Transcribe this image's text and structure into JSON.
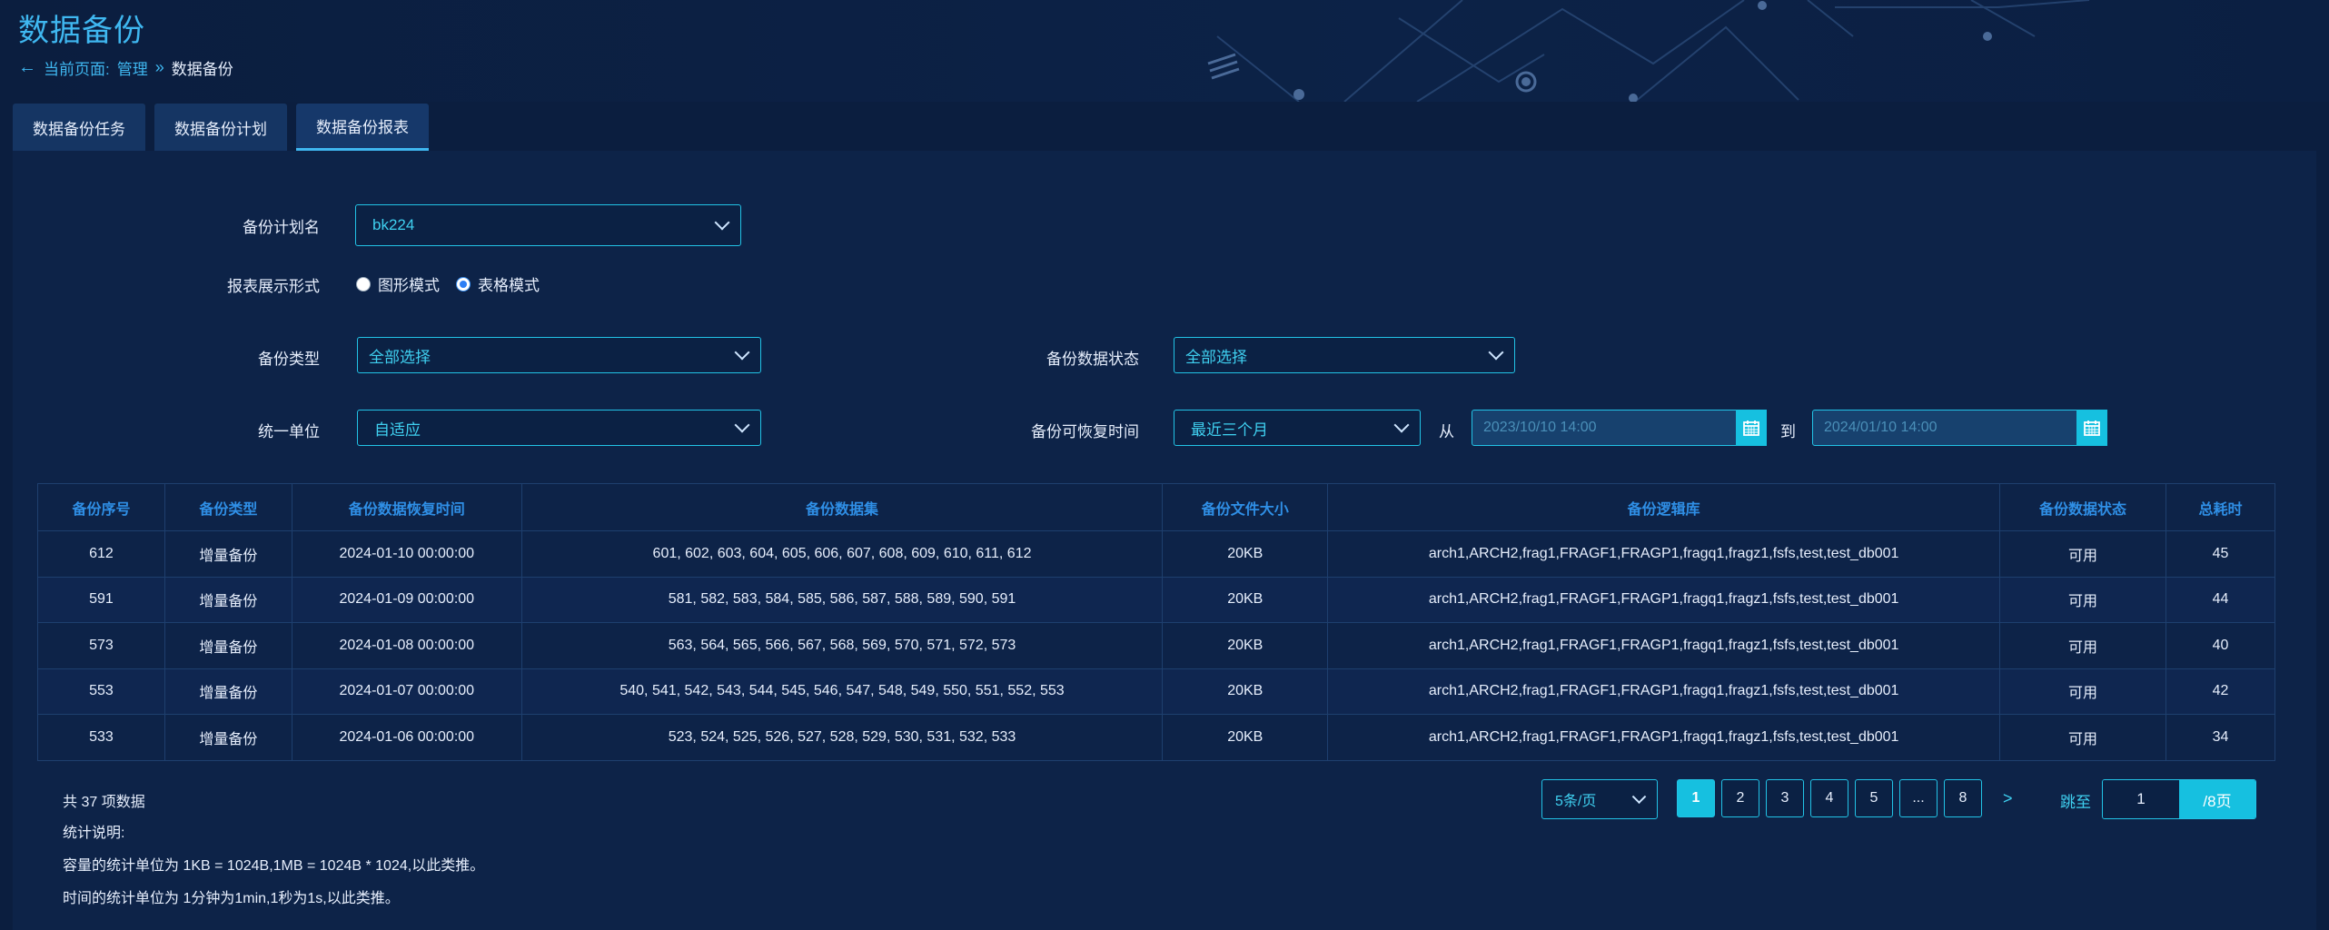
{
  "header": {
    "title": "数据备份",
    "breadcrumb": {
      "back_icon": "arrow-left-icon",
      "prefix": "当前页面:",
      "parent": "管理",
      "separator": "»",
      "current": "数据备份"
    }
  },
  "tabs": [
    {
      "label": "数据备份任务",
      "active": false
    },
    {
      "label": "数据备份计划",
      "active": false
    },
    {
      "label": "数据备份报表",
      "active": true
    }
  ],
  "form": {
    "plan_name": {
      "label": "备份计划名",
      "value": "bk224"
    },
    "display_mode": {
      "label": "报表展示形式",
      "options": [
        {
          "label": "图形模式",
          "selected": false
        },
        {
          "label": "表格模式",
          "selected": true
        }
      ]
    },
    "backup_type": {
      "label": "备份类型",
      "value": "全部选择"
    },
    "data_status": {
      "label": "备份数据状态",
      "value": "全部选择"
    },
    "unit": {
      "label": "统一单位",
      "value": "自适应"
    },
    "restore_time": {
      "label": "备份可恢复时间",
      "range_value": "最近三个月",
      "from_label": "从",
      "from_value": "2023/10/10 14:00",
      "to_label": "到",
      "to_value": "2024/01/10 14:00",
      "calendar_icon": "calendar-icon"
    }
  },
  "table": {
    "columns": [
      "备份序号",
      "备份类型",
      "备份数据恢复时间",
      "备份数据集",
      "备份文件大小",
      "备份逻辑库",
      "备份数据状态",
      "总耗时"
    ],
    "rows": [
      [
        "612",
        "增量备份",
        "2024-01-10 00:00:00",
        "601, 602, 603, 604, 605, 606, 607, 608, 609, 610, 611, 612",
        "20KB",
        "arch1,ARCH2,frag1,FRAGF1,FRAGP1,fragq1,fragz1,fsfs,test,test_db001",
        "可用",
        "45"
      ],
      [
        "591",
        "增量备份",
        "2024-01-09 00:00:00",
        "581, 582, 583, 584, 585, 586, 587, 588, 589, 590, 591",
        "20KB",
        "arch1,ARCH2,frag1,FRAGF1,FRAGP1,fragq1,fragz1,fsfs,test,test_db001",
        "可用",
        "44"
      ],
      [
        "573",
        "增量备份",
        "2024-01-08 00:00:00",
        "563, 564, 565, 566, 567, 568, 569, 570, 571, 572, 573",
        "20KB",
        "arch1,ARCH2,frag1,FRAGF1,FRAGP1,fragq1,fragz1,fsfs,test,test_db001",
        "可用",
        "40"
      ],
      [
        "553",
        "增量备份",
        "2024-01-07 00:00:00",
        "540, 541, 542, 543, 544, 545, 546, 547, 548, 549, 550, 551, 552, 553",
        "20KB",
        "arch1,ARCH2,frag1,FRAGF1,FRAGP1,fragq1,fragz1,fsfs,test,test_db001",
        "可用",
        "42"
      ],
      [
        "533",
        "增量备份",
        "2024-01-06 00:00:00",
        "523, 524, 525, 526, 527, 528, 529, 530, 531, 532, 533",
        "20KB",
        "arch1,ARCH2,frag1,FRAGF1,FRAGP1,fragq1,fragz1,fsfs,test,test_db001",
        "可用",
        "34"
      ]
    ]
  },
  "footer": {
    "total": "共 37 项数据",
    "notes_title": "统计说明:",
    "note1": "容量的统计单位为 1KB = 1024B,1MB = 1024B * 1024,以此类推。",
    "note2": "时间的统计单位为 1分钟为1min,1秒为1s,以此类推。"
  },
  "pagination": {
    "page_size": "5条/页",
    "pages": [
      "1",
      "2",
      "3",
      "4",
      "5",
      "...",
      "8"
    ],
    "current": "1",
    "next": ">",
    "jump_label": "跳至",
    "jump_value": "1",
    "total_pages": "/8页"
  },
  "colors": {
    "background": "#0b1e3f",
    "accent": "#16c0e0",
    "header_text": "#2f8fe6",
    "title": "#3fb7f0"
  }
}
